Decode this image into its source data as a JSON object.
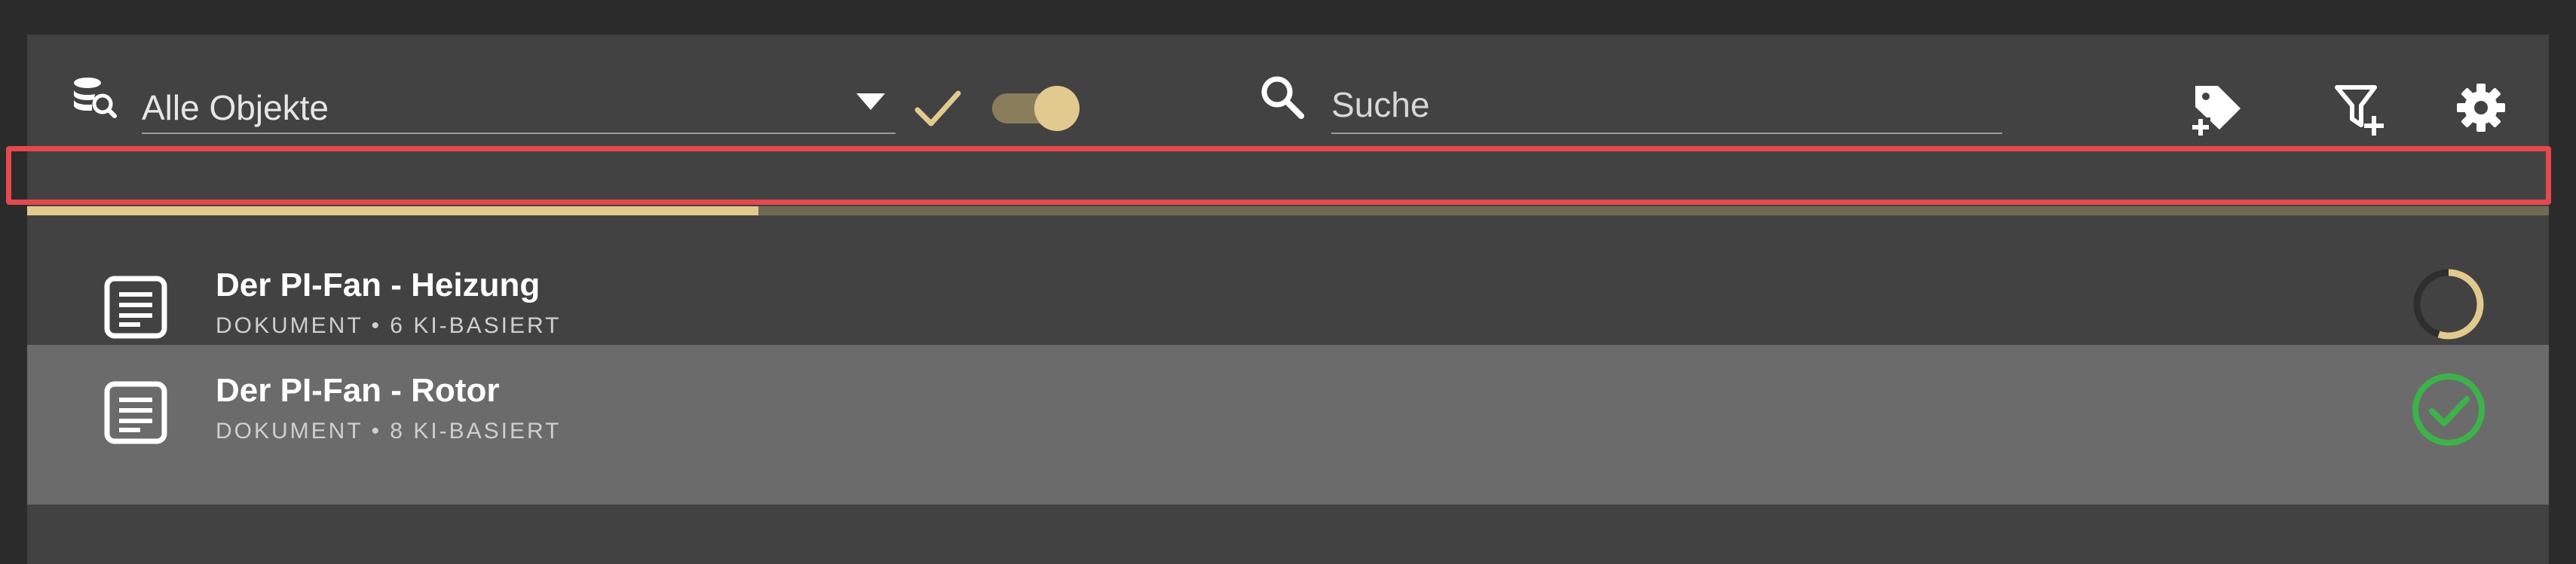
{
  "toolbar": {
    "object_filter": {
      "selected": "Alle Objekte",
      "icon": "database-search-icon"
    },
    "confirm_icon": "checkmark-icon",
    "toggle_on": true,
    "search": {
      "placeholder": "Suche",
      "value": "",
      "icon": "search-icon"
    },
    "actions": [
      {
        "name": "add-tag",
        "icon": "tag-plus-icon"
      },
      {
        "name": "add-filter",
        "icon": "filter-plus-icon"
      },
      {
        "name": "settings",
        "icon": "gear-icon"
      }
    ]
  },
  "progress": {
    "fraction": 0.29,
    "highlight_color": "#e5484d",
    "fill_color": "#e2c98e",
    "track_color": "#6f6a55"
  },
  "items": [
    {
      "title": "Der PI-Fan - Heizung",
      "meta": "DOKUMENT • 6 KI-BASIERT",
      "icon": "document-icon",
      "status": "in-progress",
      "status_fraction": 0.55
    },
    {
      "title": "Der PI-Fan - Rotor",
      "meta": "DOKUMENT • 8 KI-BASIERT",
      "icon": "document-icon",
      "status": "completed",
      "status_color": "#3cb34a"
    }
  ],
  "colors": {
    "accent": "#e2c98e",
    "success": "#3cb34a",
    "panel": "#424242",
    "selected_row": "#6b6b6b"
  }
}
